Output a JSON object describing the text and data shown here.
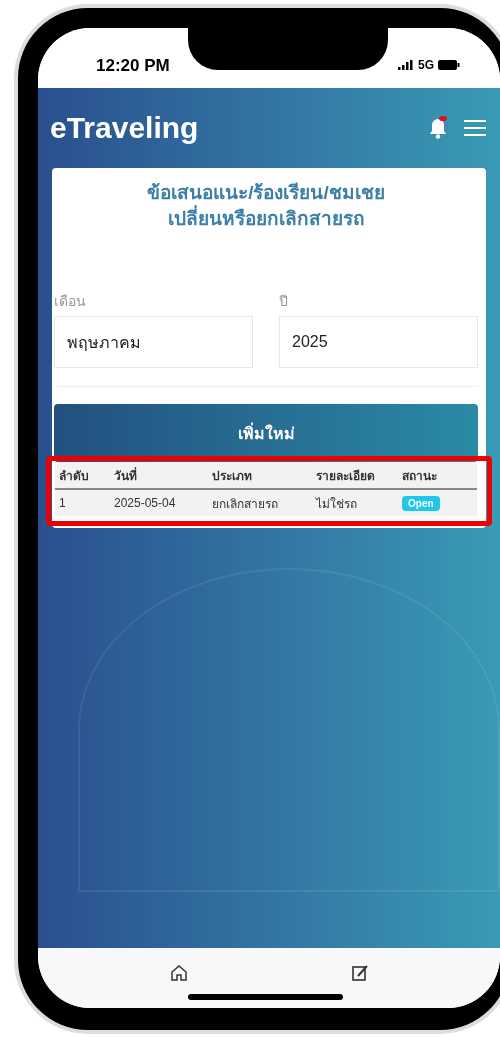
{
  "status_bar": {
    "time": "12:20 PM",
    "network": "5G"
  },
  "app_bar": {
    "title": "eTraveling",
    "has_notification": true
  },
  "card": {
    "title_lines": [
      "ข้อเสนอแนะ/ร้องเรียน/ชมเชย",
      "เปลี่ยนหรือยกเลิกสายรถ"
    ],
    "fields": [
      {
        "label": "เดือน",
        "value": "พฤษภาคม"
      },
      {
        "label": "ปี",
        "value": "2025"
      }
    ],
    "add_button": "เพิ่มใหม่",
    "table": {
      "columns": [
        "ลำดับ",
        "วันที่",
        "ประเภท",
        "รายละเอียด",
        "สถานะ"
      ],
      "rows": [
        {
          "cells": [
            "1",
            "2025-05-04",
            "ยกเลิกสายรถ",
            "ไม่ใช่รถ"
          ],
          "status": "Open",
          "color": "#1ec8ea"
        }
      ]
    }
  },
  "highlight": true
}
